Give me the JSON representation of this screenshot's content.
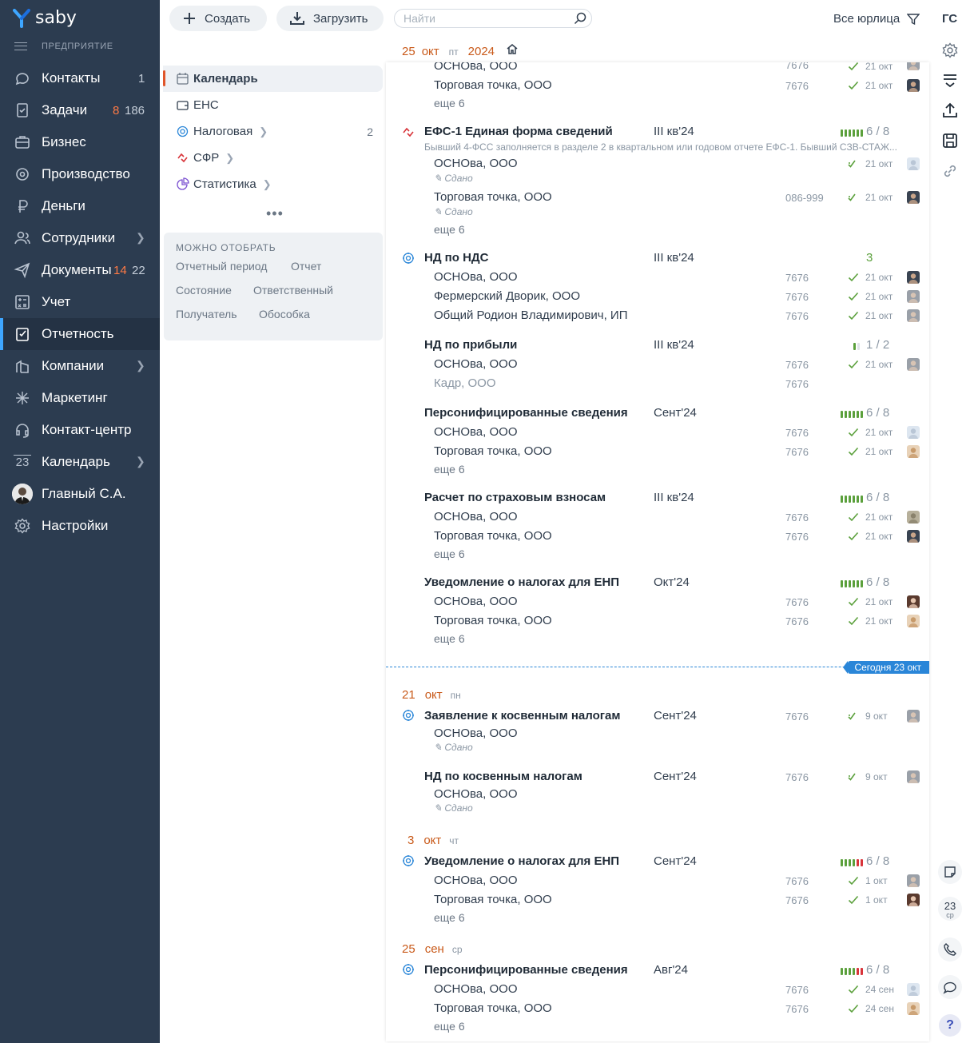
{
  "app": {
    "logo": "saby",
    "section": "ПРЕДПРИЯТИЕ"
  },
  "nav": [
    {
      "label": "Контакты",
      "icon": "chat-icon",
      "count1": "1",
      "count1_color": "grey"
    },
    {
      "label": "Задачи",
      "icon": "tasks-icon",
      "count1": "8",
      "count2": "186"
    },
    {
      "label": "Бизнес",
      "icon": "business-icon"
    },
    {
      "label": "Производство",
      "icon": "production-icon"
    },
    {
      "label": "Деньги",
      "icon": "money-icon"
    },
    {
      "label": "Сотрудники",
      "icon": "employees-icon",
      "chevron": true
    },
    {
      "label": "Документы",
      "icon": "documents-icon",
      "count1": "14",
      "count2": "22"
    },
    {
      "label": "Учет",
      "icon": "accounting-icon"
    },
    {
      "label": "Отчетность",
      "icon": "reports-icon",
      "active": true
    },
    {
      "label": "Компании",
      "icon": "companies-icon",
      "chevron": true
    },
    {
      "label": "Маркетинг",
      "icon": "marketing-icon"
    },
    {
      "label": "Контакт-центр",
      "icon": "headset-icon"
    },
    {
      "label": "Календарь",
      "icon": "calendar-icon",
      "chevron": true,
      "icon_text": "23"
    },
    {
      "label": "Главный С.А.",
      "icon": "user-avatar"
    },
    {
      "label": "Настройки",
      "icon": "settings-icon"
    }
  ],
  "toolbar": {
    "create": "Создать",
    "upload": "Загрузить",
    "search_placeholder": "Найти",
    "all_orgs": "Все юрлица",
    "user_initials": "ГС"
  },
  "date_header": {
    "day": "25",
    "month": "окт",
    "weekday": "пт",
    "year": "2024"
  },
  "left_panel": {
    "items": [
      {
        "label": "Календарь",
        "selected": true,
        "icon": "calendar-small-icon"
      },
      {
        "label": "ЕНС",
        "icon": "wallet-icon"
      },
      {
        "label": "Налоговая",
        "icon": "tax-icon",
        "chevron": true,
        "count": "2"
      },
      {
        "label": "СФР",
        "icon": "sfr-icon",
        "chevron": true
      },
      {
        "label": "Статистика",
        "icon": "stats-icon",
        "chevron": true
      }
    ],
    "filter_title": "МОЖНО ОТОБРАТЬ",
    "filters": [
      "Отчетный период",
      "Отчет",
      "Состояние",
      "Ответственный",
      "Получатель",
      "Обособка"
    ]
  },
  "today_label": "Сегодня 23 окт",
  "sections": {
    "top": {
      "r0": {
        "name": "ОСНОва, ООО",
        "num": "7676",
        "date": "21 окт"
      },
      "r1": {
        "name": "Торговая точка, ООО",
        "num": "7676",
        "date": "21 окт"
      },
      "more": "еще 6"
    },
    "efs": {
      "title": "ЕФС-1 Единая форма сведений",
      "period": "III кв'24",
      "progress": "6 / 8",
      "desc": "Бывший 4-ФСС заполняется в разделе 2 в квартальном или годовом отчете ЕФС-1. Бывший СЗВ-СТАЖ...",
      "r0": {
        "name": "ОСНОва, ООО",
        "status": "Сдано",
        "date": "21 окт"
      },
      "r1": {
        "name": "Торговая точка, ООО",
        "status": "Сдано",
        "num": "086-999",
        "date": "21 окт"
      },
      "more": "еще 6"
    },
    "nds": {
      "title": "НД по НДС",
      "period": "III кв'24",
      "progress": "3",
      "r0": {
        "name": "ОСНОва, ООО",
        "num": "7676",
        "date": "21 окт"
      },
      "r1": {
        "name": "Фермерский Дворик, ООО",
        "num": "7676",
        "date": "21 окт"
      },
      "r2": {
        "name": "Общий Родион Владимирович, ИП",
        "num": "7676",
        "date": "21 окт"
      }
    },
    "profit": {
      "title": "НД по прибыли",
      "period": "III кв'24",
      "progress": "1 / 2",
      "r0": {
        "name": "ОСНОва, ООО",
        "num": "7676",
        "date": "21 окт"
      },
      "r1": {
        "name": "Кадр, ООО",
        "num": "7676"
      }
    },
    "pers": {
      "title": "Персонифицированные сведения",
      "period": "Сент'24",
      "progress": "6 / 8",
      "r0": {
        "name": "ОСНОва, ООО",
        "num": "7676",
        "date": "21 окт"
      },
      "r1": {
        "name": "Торговая точка, ООО",
        "num": "7676",
        "date": "21 окт"
      },
      "more": "еще 6"
    },
    "ins": {
      "title": "Расчет по страховым взносам",
      "period": "III кв'24",
      "progress": "6 / 8",
      "r0": {
        "name": "ОСНОва, ООО",
        "num": "7676",
        "date": "21 окт"
      },
      "r1": {
        "name": "Торговая точка, ООО",
        "num": "7676",
        "date": "21 окт"
      },
      "more": "еще 6"
    },
    "enp": {
      "title": "Уведомление о налогах для ЕНП",
      "period": "Окт'24",
      "progress": "6 / 8",
      "r0": {
        "name": "ОСНОва, ООО",
        "num": "7676",
        "date": "21 окт"
      },
      "r1": {
        "name": "Торговая точка, ООО",
        "num": "7676",
        "date": "21 окт"
      },
      "more": "еще 6"
    },
    "day21": {
      "day": "21",
      "month": "окт",
      "weekday": "пн"
    },
    "kos1": {
      "title": "Заявление к косвенным налогам",
      "period": "Сент'24",
      "num": "7676",
      "date": "9 окт",
      "r0": {
        "name": "ОСНОва, ООО",
        "status": "Сдано"
      }
    },
    "kos2": {
      "title": "НД по косвенным налогам",
      "period": "Сент'24",
      "num": "7676",
      "date": "9 окт",
      "r0": {
        "name": "ОСНОва, ООО",
        "status": "Сдано"
      }
    },
    "day3": {
      "day": "3",
      "month": "окт",
      "weekday": "чт"
    },
    "enp2": {
      "title": "Уведомление о налогах для ЕНП",
      "period": "Сент'24",
      "progress": "6 / 8",
      "r0": {
        "name": "ОСНОва, ООО",
        "num": "7676",
        "date": "1 окт"
      },
      "r1": {
        "name": "Торговая точка, ООО",
        "num": "7676",
        "date": "1 окт"
      },
      "more": "еще 6"
    },
    "day25": {
      "day": "25",
      "month": "сен",
      "weekday": "ср"
    },
    "pers2": {
      "title": "Персонифицированные сведения",
      "period": "Авг'24",
      "progress": "6 / 8",
      "r0": {
        "name": "ОСНОва, ООО",
        "num": "7676",
        "date": "24 сен"
      },
      "r1": {
        "name": "Торговая точка, ООО",
        "num": "7676",
        "date": "24 сен"
      },
      "more": "еще 6"
    }
  },
  "right_bar": {
    "calendar_day": "23",
    "calendar_weekday": "ср",
    "help": "?"
  },
  "colors": {
    "sidebar": "#2c3c50",
    "accent_orange": "#c95a1a",
    "accent_blue": "#2a86d8",
    "green": "#5ba03c",
    "red": "#d8343a"
  }
}
